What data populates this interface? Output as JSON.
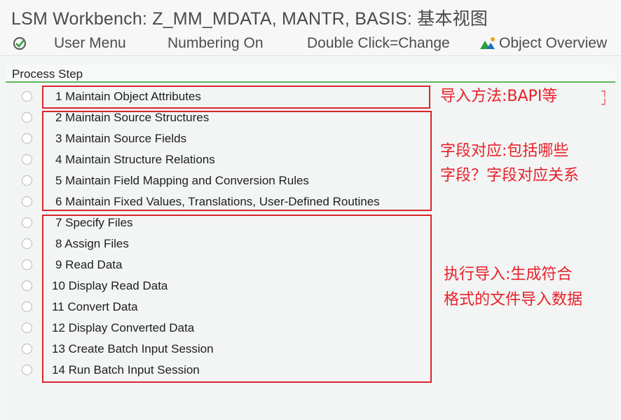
{
  "window": {
    "title": "LSM Workbench: Z_MM_MDATA, MANTR, BASIS: 基本视图"
  },
  "toolbar": {
    "user_menu": "User Menu",
    "numbering": "Numbering On",
    "double_click": "Double Click=Change",
    "object_overview": "Object Overview"
  },
  "panel": {
    "header": "Process Step"
  },
  "steps": [
    "1 Maintain Object Attributes",
    "2 Maintain Source Structures",
    "3 Maintain Source Fields",
    "4 Maintain Structure Relations",
    "5 Maintain Field Mapping and Conversion Rules",
    "6 Maintain Fixed Values, Translations, User-Defined Routines",
    "7 Specify Files",
    "8 Assign Files",
    "9 Read Data",
    "10 Display Read Data",
    "11 Convert Data",
    "12 Display Converted Data",
    "13 Create Batch Input Session",
    "14 Run Batch Input Session"
  ],
  "annotations": {
    "group1": "导入方法:BAPI等",
    "group2_line1": "字段对应:包括哪些",
    "group2_line2": "字段？字段对应关系",
    "group3_line1": "执行导入:生成符合",
    "group3_line2": "格式的文件导入数据"
  },
  "colors": {
    "annotation": "#e8212a",
    "header_line": "#5cb85c"
  }
}
